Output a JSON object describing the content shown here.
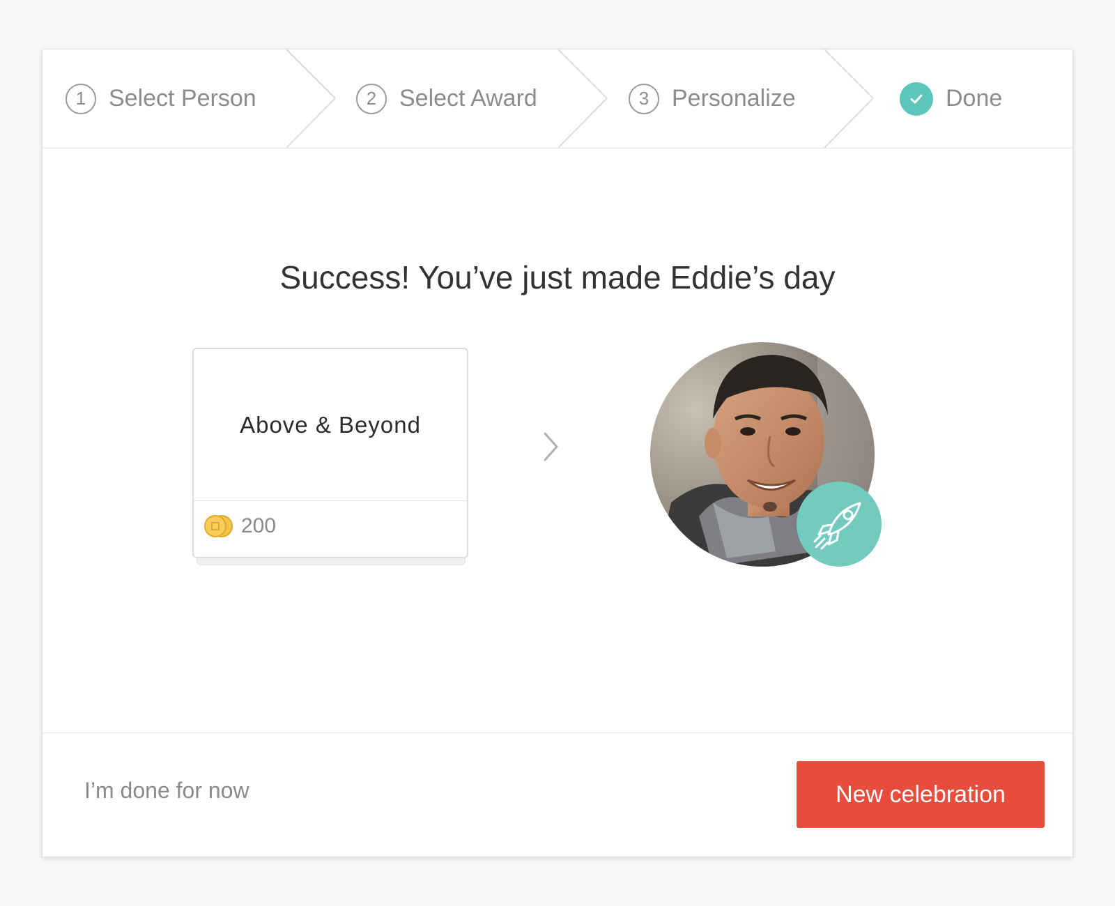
{
  "stepper": {
    "steps": [
      {
        "number": "1",
        "label": "Select Person"
      },
      {
        "number": "2",
        "label": "Select Award"
      },
      {
        "number": "3",
        "label": "Personalize"
      },
      {
        "number": "",
        "label": "Done",
        "icon": "check-icon"
      }
    ]
  },
  "headline": "Success! You’ve just made Eddie’s day",
  "award": {
    "name": "Above & Beyond",
    "points": "200",
    "points_icon": "coin-icon"
  },
  "recipient": {
    "badge_icon": "rocket-icon"
  },
  "footer": {
    "dismiss_label": "I’m done for now",
    "primary_label": "New celebration"
  },
  "colors": {
    "accent": "#5cc6ba",
    "primary_button": "#e84c3d",
    "coin": "#f5c24a"
  }
}
